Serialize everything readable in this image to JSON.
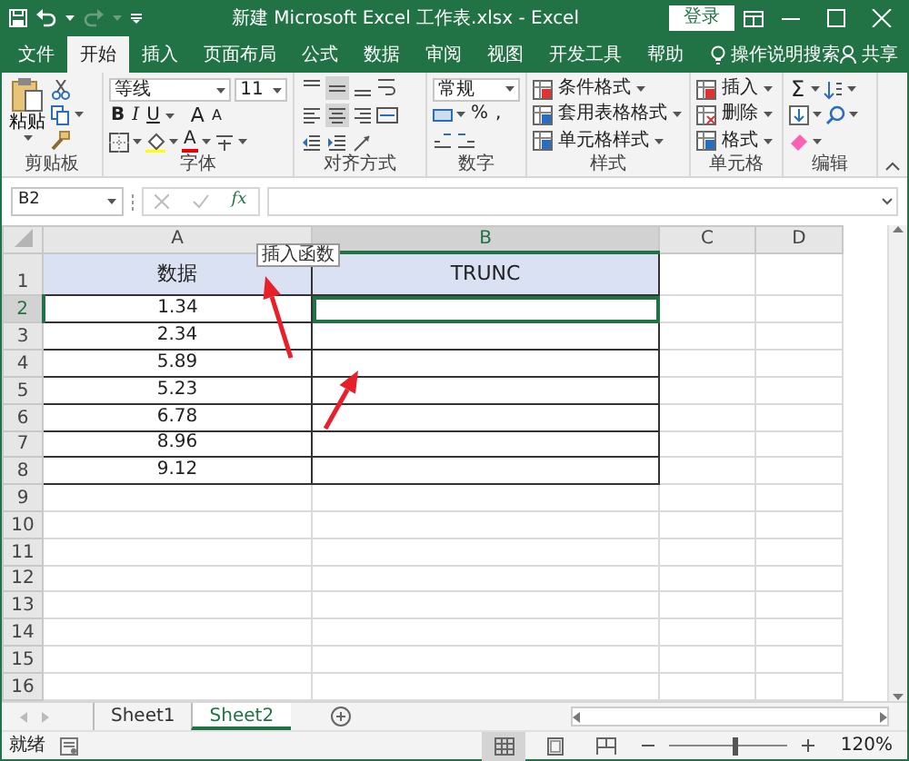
{
  "title_bar": {
    "title": "新建 Microsoft Excel 工作表.xlsx  -  Excel",
    "login": "登录"
  },
  "ribbon_tabs": [
    {
      "label": "文件",
      "selected": false
    },
    {
      "label": "开始",
      "selected": true
    },
    {
      "label": "插入",
      "selected": false
    },
    {
      "label": "页面布局",
      "selected": false
    },
    {
      "label": "公式",
      "selected": false
    },
    {
      "label": "数据",
      "selected": false
    },
    {
      "label": "审阅",
      "selected": false
    },
    {
      "label": "视图",
      "selected": false
    },
    {
      "label": "开发工具",
      "selected": false
    },
    {
      "label": "帮助",
      "selected": false
    }
  ],
  "tell_me": "操作说明搜索",
  "share": "共享",
  "ribbon_groups": [
    {
      "kind": "clipboard",
      "label": "剪贴板",
      "paste": "粘贴"
    },
    {
      "kind": "font",
      "label": "字体",
      "font_name": "等线",
      "font_size": "11",
      "bold": "B",
      "italic": "I",
      "underline": "U",
      "grow": "A",
      "shrink": "A",
      "font_color": "A"
    },
    {
      "kind": "alignment",
      "label": "对齐方式",
      "buttons": [
        {
          "kind": "top",
          "on": false
        },
        {
          "kind": "middle",
          "on": true
        },
        {
          "kind": "bottom",
          "on": false
        },
        {
          "kind": "left",
          "on": false
        },
        {
          "kind": "center",
          "on": true
        },
        {
          "kind": "right",
          "on": false
        },
        {
          "kind": "outdent",
          "on": false
        },
        {
          "kind": "indent",
          "on": false
        },
        {
          "kind": "orientation",
          "on": false
        }
      ]
    },
    {
      "kind": "number",
      "label": "数字",
      "format": "常规",
      "percent": "%",
      "comma": ","
    },
    {
      "kind": "styles",
      "label": "样式",
      "items": [
        "条件格式",
        "套用表格格式",
        "单元格样式"
      ]
    },
    {
      "kind": "cells",
      "label": "单元格",
      "items": [
        "插入",
        "删除",
        "格式"
      ]
    },
    {
      "kind": "editing",
      "label": "编辑",
      "sum": "Σ"
    }
  ],
  "formula_bar": {
    "name_box": "B2",
    "fx": "fx"
  },
  "tooltip": "插入函数",
  "sheet": {
    "columns": [
      {
        "label": "A",
        "selected": false
      },
      {
        "label": "B",
        "selected": true
      },
      {
        "label": "C",
        "selected": false
      },
      {
        "label": "D",
        "selected": false
      }
    ],
    "rows": [
      {
        "label": "1",
        "selected": false,
        "cells": [
          "数据",
          "TRUNC"
        ]
      },
      {
        "label": "2",
        "selected": true,
        "cells": [
          "1.34",
          ""
        ]
      },
      {
        "label": "3",
        "selected": false,
        "cells": [
          "2.34",
          ""
        ]
      },
      {
        "label": "4",
        "selected": false,
        "cells": [
          "5.89",
          ""
        ]
      },
      {
        "label": "5",
        "selected": false,
        "cells": [
          "5.23",
          ""
        ]
      },
      {
        "label": "6",
        "selected": false,
        "cells": [
          "6.78",
          ""
        ]
      },
      {
        "label": "7",
        "selected": false,
        "cells": [
          "8.96",
          ""
        ]
      },
      {
        "label": "8",
        "selected": false,
        "cells": [
          "9.12",
          ""
        ]
      },
      {
        "label": "9",
        "selected": false,
        "cells": []
      },
      {
        "label": "10",
        "selected": false,
        "cells": []
      },
      {
        "label": "11",
        "selected": false,
        "cells": []
      },
      {
        "label": "12",
        "selected": false,
        "cells": []
      },
      {
        "label": "13",
        "selected": false,
        "cells": []
      },
      {
        "label": "14",
        "selected": false,
        "cells": []
      },
      {
        "label": "15",
        "selected": false,
        "cells": []
      },
      {
        "label": "16",
        "selected": false,
        "cells": []
      }
    ],
    "active_cell": {
      "selected": true
    }
  },
  "sheet_tabs": [
    {
      "label": "Sheet1",
      "selected": false
    },
    {
      "label": "Sheet2",
      "selected": true
    }
  ],
  "status_bar": {
    "status": "就绪",
    "views": [
      {
        "kind": "normal",
        "selected": true
      },
      {
        "kind": "page_layout",
        "selected": false
      },
      {
        "kind": "page_break",
        "selected": false
      }
    ],
    "zoom": {
      "level": 0.55
    },
    "zoom_text": "120%"
  }
}
